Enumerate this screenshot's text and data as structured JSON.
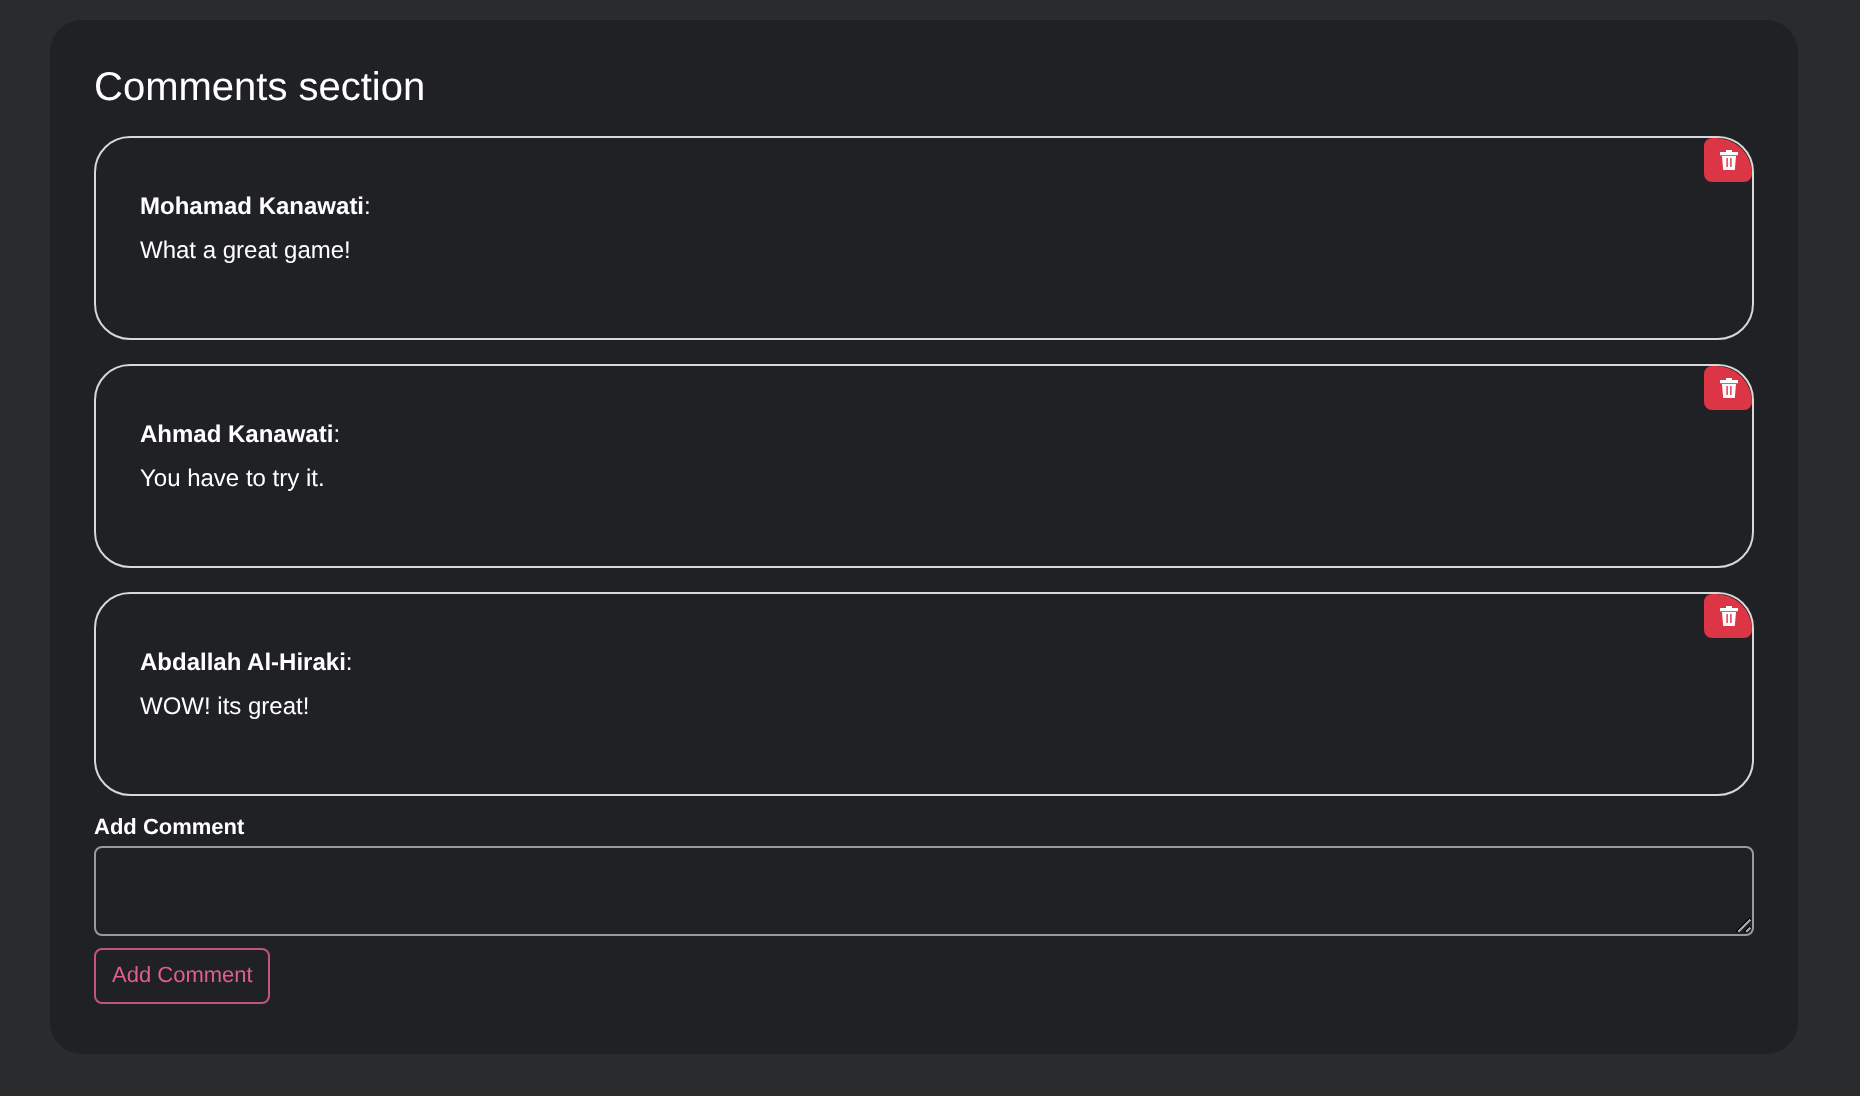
{
  "title": "Comments section",
  "comments": [
    {
      "author": "**Mohamad Kanawati**:",
      "text": "What a great game!"
    },
    {
      "author": "**Ahmad Kanawati**:",
      "text": "You have to try it."
    },
    {
      "author": "**Abdallah Al-Hiraki**:",
      "text": "WOW! its great!"
    }
  ],
  "form": {
    "label": "Add Comment",
    "button": "Add Comment"
  }
}
